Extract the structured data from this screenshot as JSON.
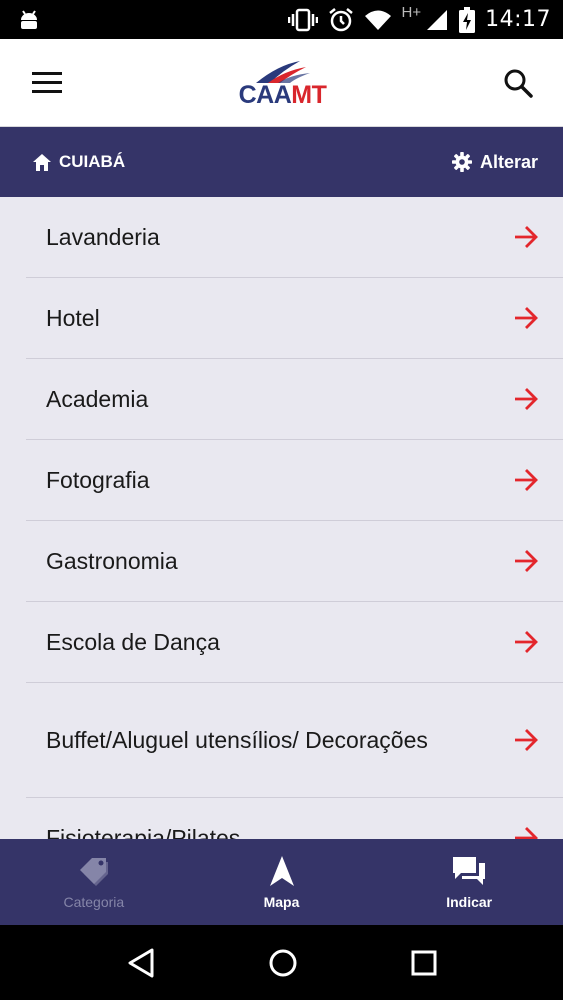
{
  "status_bar": {
    "network": "H+",
    "time": "14:17"
  },
  "app_bar": {
    "logo_caa": "CAA",
    "logo_mt": "MT"
  },
  "location": {
    "city": "CUIABÁ",
    "change_label": "Alterar"
  },
  "categories": [
    "Lavanderia",
    "Hotel",
    "Academia",
    "Fotografia",
    "Gastronomia",
    "Escola de Dança",
    "Buffet/Aluguel utensílios/ Decorações",
    "Fisioterapia/Pilates"
  ],
  "bottom_nav": {
    "tabs": [
      {
        "label": "Categoria",
        "icon": "tag-icon"
      },
      {
        "label": "Mapa",
        "icon": "navigation-arrow-icon"
      },
      {
        "label": "Indicar",
        "icon": "chat-bubbles-icon"
      }
    ]
  },
  "colors": {
    "primary": "#353468",
    "accent_arrow": "#e3262c",
    "list_bg": "#e9e8f0",
    "logo_blue": "#2a3a7c",
    "logo_red": "#d9262c"
  }
}
